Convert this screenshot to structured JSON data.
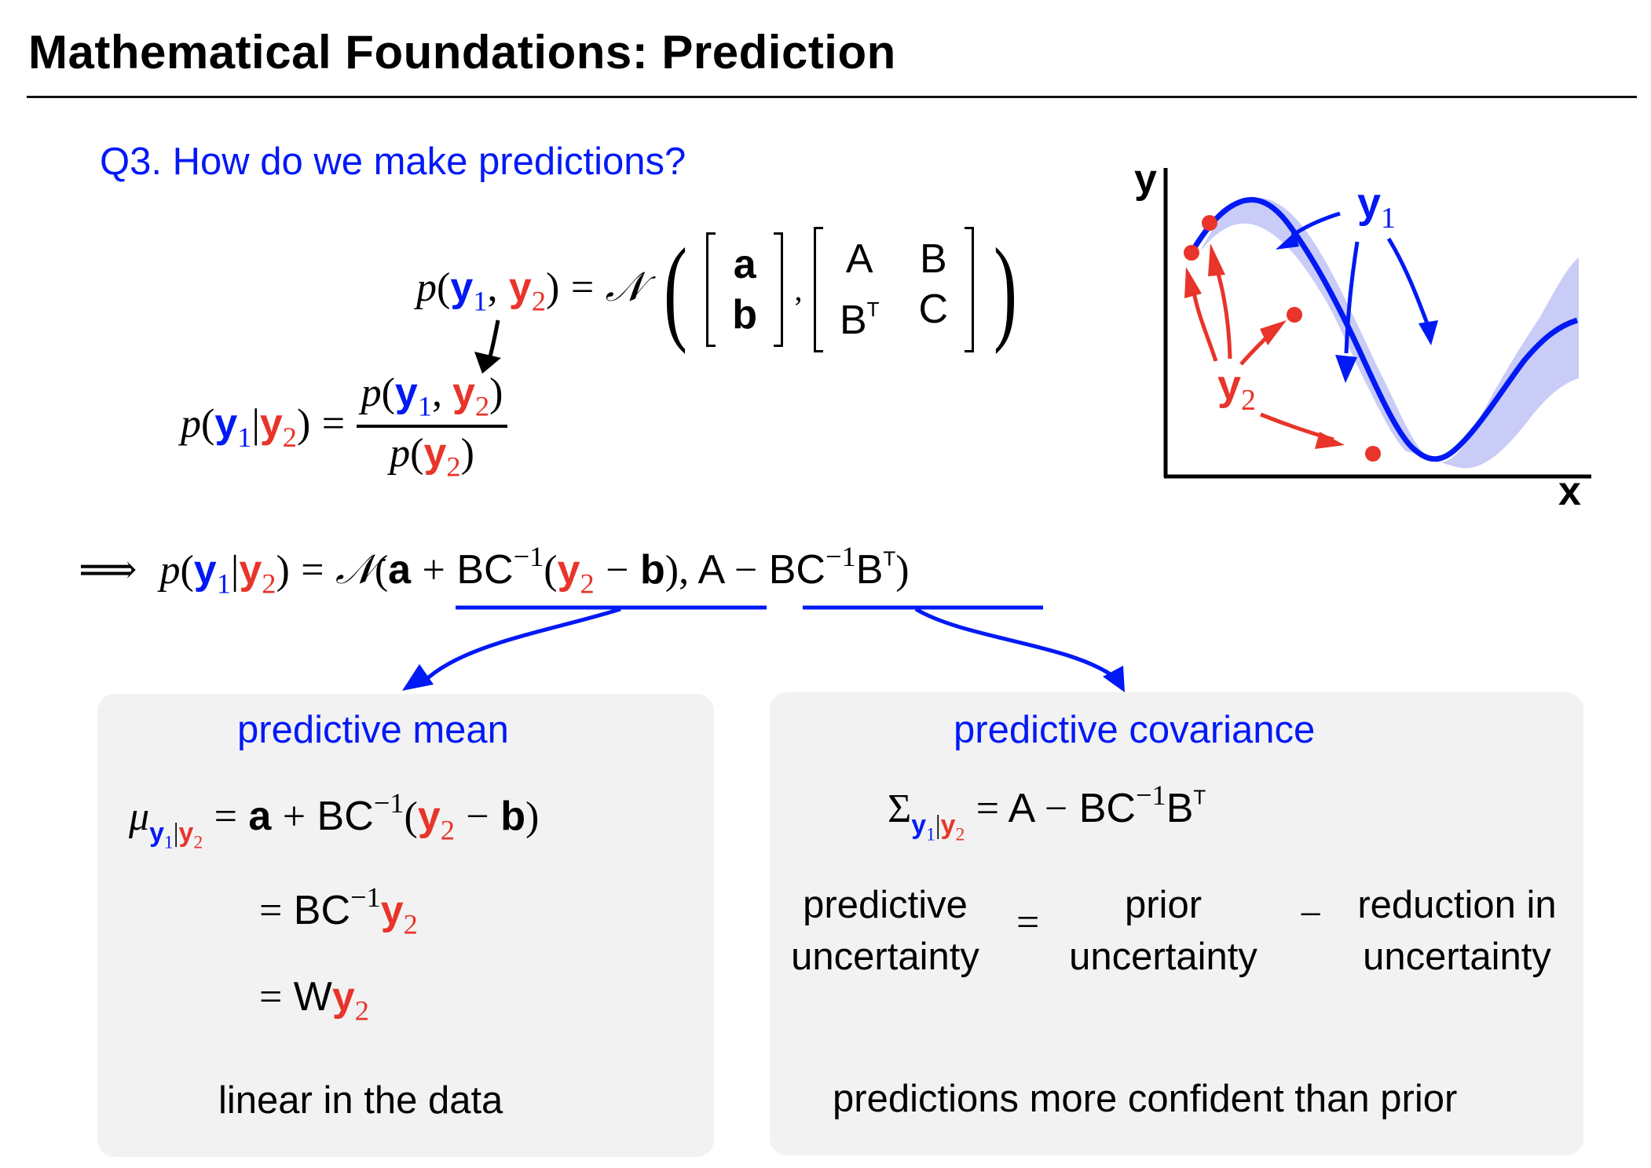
{
  "slide": {
    "title": "Mathematical Foundations:  Prediction",
    "question": "Q3. How do we make predictions?"
  },
  "colors": {
    "y1": "#0019f5",
    "y2": "#e8342a",
    "accent": "#0019f5",
    "panel_bg": "#f2f2f2",
    "band": "#c9ccf7"
  },
  "joint": {
    "p": "p",
    "open": "(",
    "y": "y",
    "sub1": "1",
    "comma": ",",
    "sub2": "2",
    "close": ")",
    "eq": "=",
    "normal": "𝒩",
    "mean_vec": [
      "a",
      "b"
    ],
    "cov": [
      "A",
      "B",
      "B",
      "C"
    ],
    "transpose": "T",
    "sep": ","
  },
  "bayes": {
    "lhs": {
      "p": "p",
      "bar": "|"
    },
    "eq": "=",
    "numerator": "p(y1, y2)",
    "denominator": "p(y2)"
  },
  "result": {
    "implies": "⟹",
    "eq": "=",
    "normal": "𝒩",
    "mean_a": "a",
    "plus": "+",
    "BC": "BC",
    "inv": "−1",
    "minus": "−",
    "b": "b",
    "A": "A",
    "B": "B",
    "T": "T"
  },
  "panels": {
    "mean": {
      "title": "predictive mean",
      "mu": "μ",
      "line1_rhs": [
        "a",
        "+",
        "BC",
        "−1",
        "(",
        "y",
        "2",
        "−",
        "b",
        ")"
      ],
      "line2": [
        "=",
        "BC",
        "−1",
        "y",
        "2"
      ],
      "line3": [
        "=",
        "W",
        "y",
        "2"
      ],
      "caption": "linear in the data"
    },
    "cov": {
      "title": "predictive covariance",
      "sigma": "Σ",
      "rhs": [
        "A",
        "−",
        "BC",
        "−1",
        "B",
        "T"
      ],
      "words": {
        "w1": [
          "predictive",
          "uncertainty"
        ],
        "op1": "=",
        "w2": [
          "prior",
          "uncertainty"
        ],
        "op2": "−",
        "w3": [
          "reduction in",
          "uncertainty"
        ]
      },
      "caption": "predictions more confident than prior"
    }
  },
  "figure": {
    "x_label": "x",
    "y_label": "y",
    "y1_label": "y",
    "y1_sub": "1",
    "y2_label": "y",
    "y2_sub": "2"
  }
}
